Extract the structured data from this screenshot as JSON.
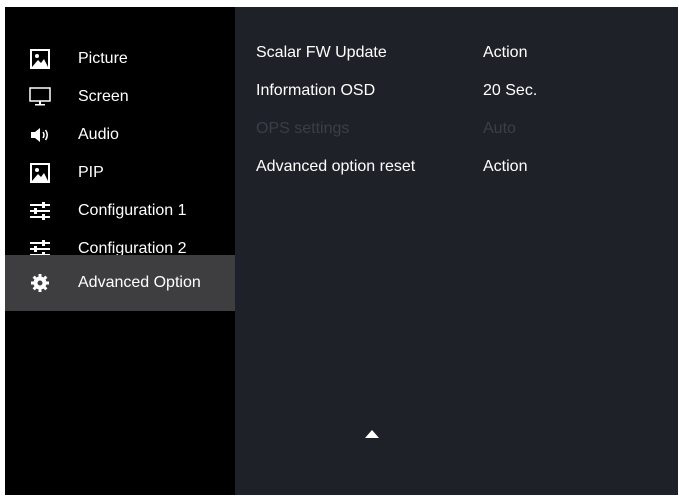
{
  "sidebar": {
    "items": [
      {
        "label": "Picture",
        "icon": "picture-icon"
      },
      {
        "label": "Screen",
        "icon": "monitor-icon"
      },
      {
        "label": "Audio",
        "icon": "speaker-icon"
      },
      {
        "label": "PIP",
        "icon": "picture-icon"
      },
      {
        "label": "Configuration 1",
        "icon": "sliders-icon"
      },
      {
        "label": "Configuration 2",
        "icon": "sliders-icon"
      },
      {
        "label": "Advanced Option",
        "icon": "gear-icon",
        "selected": true
      }
    ]
  },
  "panel": {
    "rows": [
      {
        "name": "Scalar FW Update",
        "value": "Action",
        "enabled": true
      },
      {
        "name": "Information OSD",
        "value": "20 Sec.",
        "enabled": true
      },
      {
        "name": "OPS settings",
        "value": "Auto",
        "enabled": false
      },
      {
        "name": "Advanced option reset",
        "value": "Action",
        "enabled": true
      }
    ],
    "scroll_indicator": "up-arrow-icon"
  },
  "colors": {
    "sidebar_bg": "#000000",
    "panel_bg": "#1e2228",
    "selected_bg": "#3e3e40",
    "text": "#ffffff",
    "disabled_text": "#3a3f47"
  }
}
